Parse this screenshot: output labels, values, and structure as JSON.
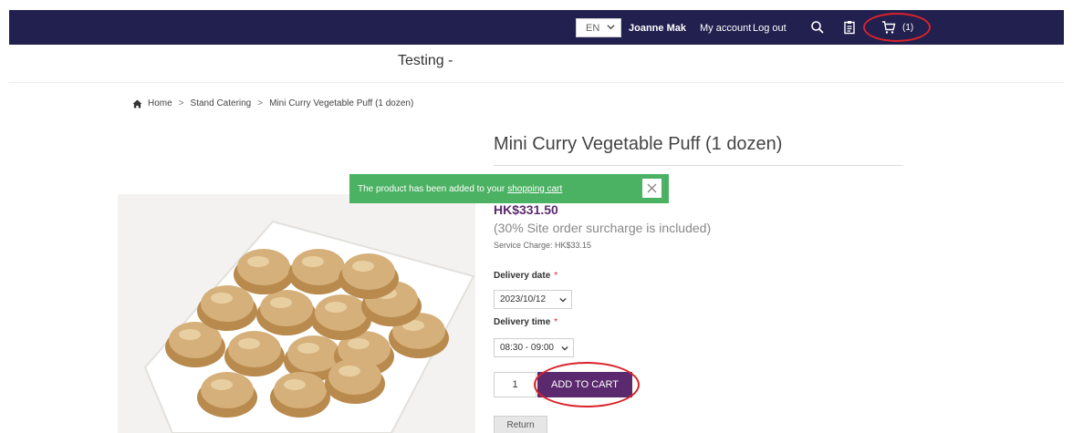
{
  "header": {
    "language": "EN",
    "user_name": "Joanne Mak",
    "my_account": "My account",
    "log_out": "Log out",
    "cart_count": "(1)",
    "icons": [
      "search-icon",
      "clipboard-icon",
      "cart-icon"
    ]
  },
  "site": {
    "title": "Testing -"
  },
  "breadcrumb": {
    "home": "Home",
    "category": "Stand Catering",
    "current": "Mini Curry Vegetable Puff (1 dozen)"
  },
  "product": {
    "title": "Mini Curry Vegetable Puff (1 dozen)",
    "price": "HK$331.50",
    "surcharge_note": "(30% Site order surcharge is included)",
    "service_charge": "Service Charge: HK$33.15",
    "delivery_date_label": "Delivery date",
    "delivery_date_value": "2023/10/12",
    "delivery_time_label": "Delivery time",
    "delivery_time_value": "08:30 - 09:00",
    "required_mark": "*",
    "quantity": "1",
    "add_to_cart": "ADD TO CART",
    "return": "Return"
  },
  "toast": {
    "message": "The product has been added to your",
    "link": "shopping cart"
  },
  "colors": {
    "header_bg": "#22204f",
    "accent_purple": "#5b2a6e",
    "toast_green": "#4bb163",
    "annotation_red": "#d8232a"
  }
}
